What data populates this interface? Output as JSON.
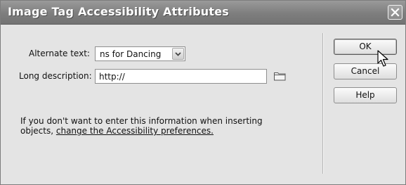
{
  "dialog": {
    "title": "Image Tag Accessibility Attributes"
  },
  "fields": {
    "alt_label": "Alternate text:",
    "alt_value": "ns for Dancing",
    "longdesc_label": "Long description:",
    "longdesc_value": "http://"
  },
  "info": {
    "line1": "If you don't want to enter this information when inserting",
    "line2_prefix": "objects, ",
    "link": "change the Accessibility preferences."
  },
  "buttons": {
    "ok": "OK",
    "cancel": "Cancel",
    "help": "Help"
  },
  "icons": [
    "close-icon",
    "dropdown-arrow-icon",
    "folder-icon",
    "mouse-cursor-icon"
  ]
}
